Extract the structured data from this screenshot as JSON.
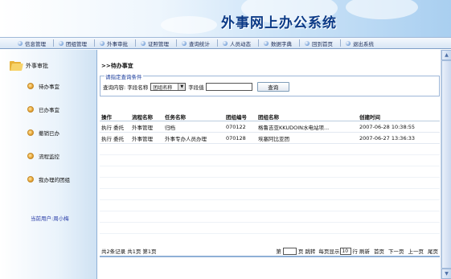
{
  "header": {
    "title": "外事网上办公系统"
  },
  "nav": {
    "items": [
      "信息管理",
      "团组管理",
      "外事审批",
      "证照管理",
      "查询统计",
      "人员动态",
      "数据字典",
      "回到首页",
      "退出系统"
    ]
  },
  "sidebar": {
    "title": "外事审批",
    "items": [
      "待办事宜",
      "已办事宜",
      "撤销已办",
      "流程监控",
      "我办理的团组"
    ],
    "current_user": "当前用户:周小梅"
  },
  "main": {
    "breadcrumb": ">>待办事宜",
    "query": {
      "legend": "请指定查询条件",
      "content_label": "查询内容: 字段名称",
      "field_select": "团组名称",
      "value_label": "字段值",
      "value": "",
      "button": "查询"
    },
    "table": {
      "headers": [
        "操作",
        "流程名称",
        "任务名称",
        "团组编号",
        "团组名称",
        "创建时间"
      ],
      "rows": [
        [
          "执行  委托",
          "外事管理",
          "归档",
          "070122",
          "格鲁吉亚KKUDOIN水电站项...",
          "2007-06-28 10:38:55"
        ],
        [
          "执行  委托",
          "外事管理",
          "外事专办人员办理",
          "070128",
          "埃塞阿比亚团",
          "2007-06-27 13:36:33"
        ]
      ]
    },
    "pager": {
      "summary": "共2条记录 共1页 第1页",
      "page_label": "第",
      "page_suffix": "页 跳转",
      "size_label": "每页显示",
      "size_value": "10",
      "size_suffix": "行 刷新",
      "first": "首页",
      "next": "下一页",
      "prev": "上一页",
      "last": "尾页"
    }
  },
  "colors": {
    "title": "#0b3a86",
    "accent": "#3a78c8",
    "border": "#8fb0d6"
  }
}
